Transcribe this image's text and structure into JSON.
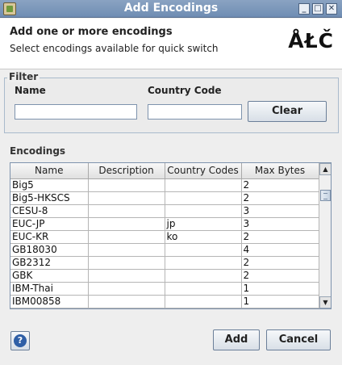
{
  "window": {
    "title": "Add Encodings"
  },
  "header": {
    "title": "Add one or more encodings",
    "subtitle": "Select encodings available for quick switch",
    "logo_text": "ÅŁČ"
  },
  "filter": {
    "legend": "Filter",
    "name_label": "Name",
    "name_value": "",
    "country_code_label": "Country Code",
    "country_code_value": "",
    "clear_label": "Clear"
  },
  "encodings": {
    "label": "Encodings",
    "columns": [
      "Name",
      "Description",
      "Country Codes",
      "Max Bytes"
    ],
    "rows": [
      [
        "Big5",
        "",
        "",
        "2"
      ],
      [
        "Big5-HKSCS",
        "",
        "",
        "2"
      ],
      [
        "CESU-8",
        "",
        "",
        "3"
      ],
      [
        "EUC-JP",
        "",
        "jp",
        "3"
      ],
      [
        "EUC-KR",
        "",
        "ko",
        "2"
      ],
      [
        "GB18030",
        "",
        "",
        "4"
      ],
      [
        "GB2312",
        "",
        "",
        "2"
      ],
      [
        "GBK",
        "",
        "",
        "2"
      ],
      [
        "IBM-Thai",
        "",
        "",
        "1"
      ],
      [
        "IBM00858",
        "",
        "",
        "1"
      ]
    ]
  },
  "footer": {
    "help_glyph": "?",
    "add_label": "Add",
    "cancel_label": "Cancel"
  }
}
